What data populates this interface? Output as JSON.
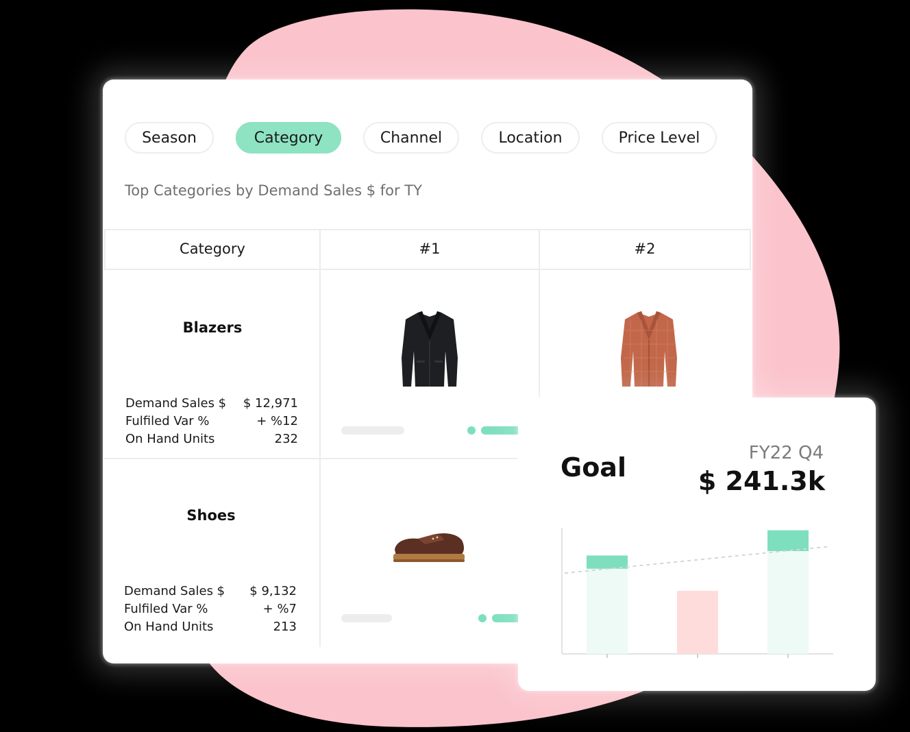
{
  "filters": [
    {
      "label": "Season",
      "active": false
    },
    {
      "label": "Category",
      "active": true
    },
    {
      "label": "Channel",
      "active": false
    },
    {
      "label": "Location",
      "active": false
    },
    {
      "label": "Price Level",
      "active": false
    }
  ],
  "subtitle": "Top Categories by Demand Sales $ for TY",
  "table": {
    "headers": [
      "Category",
      "#1",
      "#2"
    ],
    "rows": [
      {
        "name": "Blazers",
        "metrics": [
          {
            "label": "Demand Sales $",
            "value": "$ 12,971"
          },
          {
            "label": "Fulfiled Var %",
            "value": "+ %12"
          },
          {
            "label": "On Hand Units",
            "value": "232"
          }
        ],
        "products": [
          "black-blazer-image",
          "orange-plaid-blazer-image"
        ]
      },
      {
        "name": "Shoes",
        "metrics": [
          {
            "label": "Demand Sales $",
            "value": "$ 9,132"
          },
          {
            "label": "Fulfiled Var %",
            "value": "+ %7"
          },
          {
            "label": "On Hand Units",
            "value": "213"
          }
        ],
        "products": [
          "brown-boat-shoe-image"
        ]
      }
    ]
  },
  "goal": {
    "title": "Goal",
    "period": "FY22 Q4",
    "value": "$ 241.3k"
  },
  "colors": {
    "accent_green": "#8de3c2",
    "bar_green": "#7ddfbd",
    "bar_red": "#ffdcdc",
    "blob_pink": "#fbc3cb"
  },
  "chart_data": {
    "type": "bar",
    "categories": [
      "",
      "",
      ""
    ],
    "values": [
      0.78,
      0.5,
      0.98
    ],
    "status": [
      "above-target",
      "below-target",
      "above-target"
    ],
    "target_line": [
      0.64,
      0.85
    ],
    "grid": false
  }
}
